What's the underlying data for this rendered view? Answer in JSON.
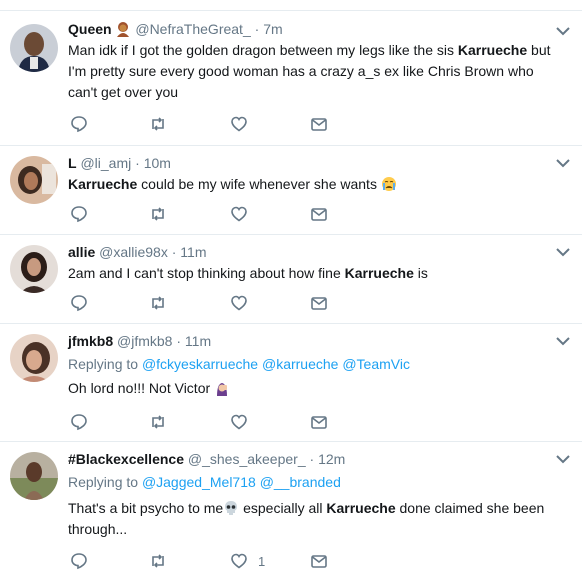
{
  "tweets": [
    {
      "name": "Queen",
      "handle": "@NefraTheGreat_",
      "dot": "·",
      "time": "7m",
      "text_before": "Man idk if I got the golden dragon between my legs like the sis ",
      "bold": "Karrueche",
      "text_after": " but I'm pretty sure every good woman has a crazy a_s ex like Chris Brown who can't get over you",
      "icons": [
        "person-emoji-icon"
      ]
    },
    {
      "name": "L",
      "handle": "@li_amj",
      "dot": "·",
      "time": "10m",
      "text_before": "",
      "bold": "Karrueche",
      "text_after": " could be my wife whenever she wants",
      "icons": [
        "crying-face-emoji-icon"
      ]
    },
    {
      "name": "allie",
      "handle": "@xallie98x",
      "dot": "·",
      "time": "11m",
      "text_before": "2am and I can't stop thinking about how fine ",
      "bold": "Karrueche",
      "text_after": " is"
    },
    {
      "name": "jfmkb8",
      "handle": "@jfmkb8",
      "dot": "·",
      "time": "11m",
      "reply_label": "Replying to",
      "mentions": [
        "@fckyeskarrueche",
        "@karrueche",
        "@TeamVic"
      ],
      "text_before": "Oh lord no!!! Not Victor",
      "icons": [
        "facepalm-emoji-icon"
      ]
    },
    {
      "name": "#Blackexcellence",
      "handle": "@_shes_akeeper_",
      "dot": "·",
      "time": "12m",
      "reply_label": "Replying to",
      "mentions": [
        "@Jagged_Mel718",
        "@__branded"
      ],
      "text_before": "That's a bit psycho to me",
      "text_mid": " especially all ",
      "bold": "Karrueche",
      "text_after": " done claimed she been through...",
      "like_count": "1",
      "icons": [
        "skull-emoji-icon"
      ]
    }
  ],
  "colors": {
    "text": "#14171a",
    "muted": "#657786",
    "link": "#1da1f2",
    "divider": "#e6ecf0"
  }
}
